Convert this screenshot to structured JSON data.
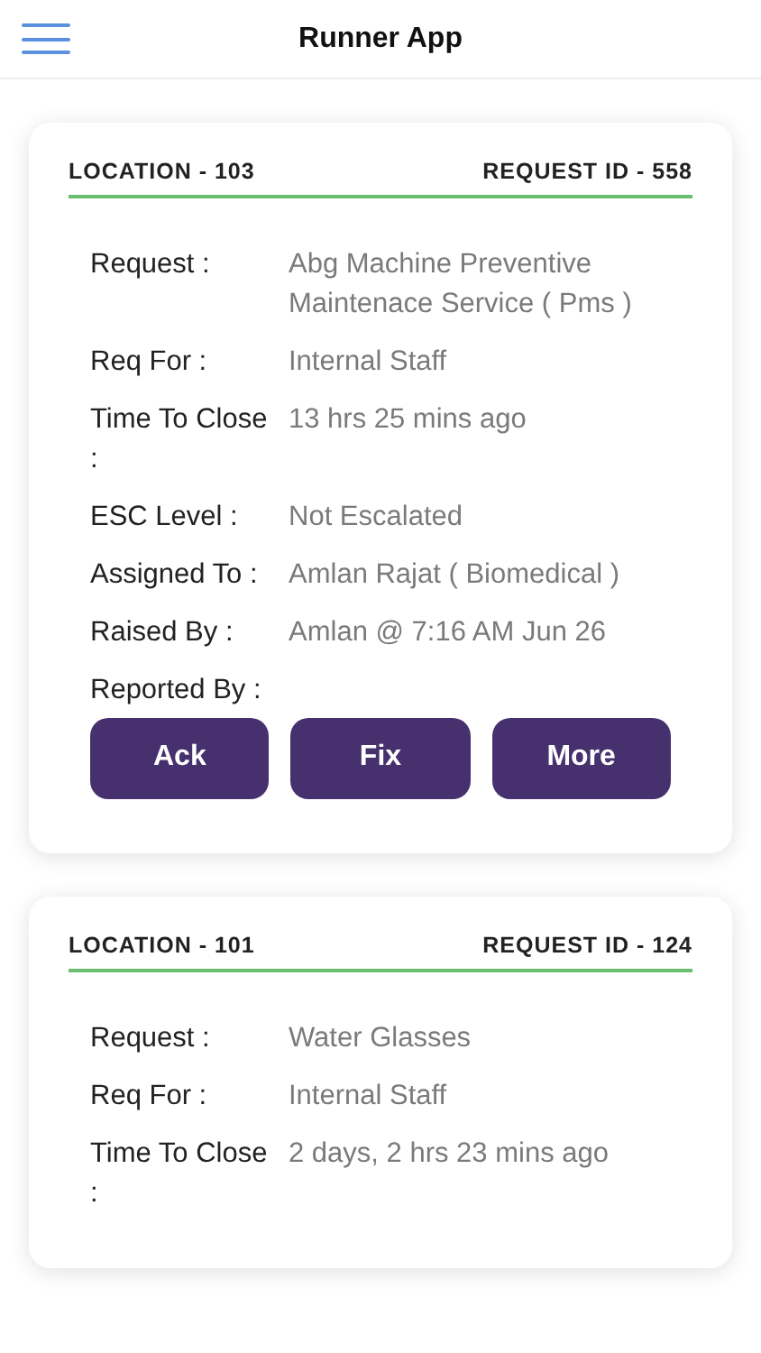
{
  "header": {
    "title": "Runner App"
  },
  "cards": [
    {
      "location": "LOCATION - 103",
      "request_id": "REQUEST ID - 558",
      "fields": [
        {
          "label": "Request :",
          "value": "Abg Machine Preventive Maintenace Service ( Pms )"
        },
        {
          "label": "Req For :",
          "value": "Internal Staff"
        },
        {
          "label": "Time To Close :",
          "value": "13 hrs 25 mins ago"
        },
        {
          "label": "ESC Level :",
          "value": "Not Escalated"
        },
        {
          "label": "Assigned To :",
          "value": "Amlan Rajat ( Biomedical )"
        },
        {
          "label": "Raised By :",
          "value": "Amlan @ 7:16 AM Jun 26"
        },
        {
          "label": "Reported By :"
        }
      ],
      "buttons": [
        "Ack",
        "Fix",
        "More"
      ]
    },
    {
      "location": "LOCATION - 101",
      "request_id": "REQUEST ID - 124",
      "fields": [
        {
          "label": "Request :",
          "value": "Water Glasses"
        },
        {
          "label": "Req For :",
          "value": "Internal Staff"
        },
        {
          "label": "Time To Close :",
          "value": "2 days, 2 hrs 23 mins ago"
        }
      ]
    }
  ]
}
